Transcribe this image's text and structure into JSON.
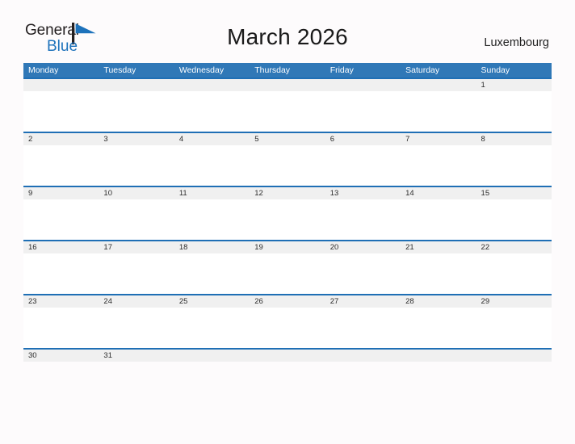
{
  "brand": {
    "name_part1": "General",
    "name_part2": "Blue",
    "flag_color": "#1d72bb",
    "pole_color": "#231f20"
  },
  "header": {
    "title": "March 2026",
    "region": "Luxembourg"
  },
  "colors": {
    "header_blue": "#3078b7",
    "divider_blue": "#1f6fb5",
    "day_strip_gray": "#f0f0f0",
    "page_background": "#fdfbfc",
    "text_dark": "#1a1a1a"
  },
  "calendar": {
    "month": "March",
    "year": "2026",
    "weekday_headers": [
      "Monday",
      "Tuesday",
      "Wednesday",
      "Thursday",
      "Friday",
      "Saturday",
      "Sunday"
    ],
    "weeks": [
      [
        "",
        "",
        "",
        "",
        "",
        "",
        "1"
      ],
      [
        "2",
        "3",
        "4",
        "5",
        "6",
        "7",
        "8"
      ],
      [
        "9",
        "10",
        "11",
        "12",
        "13",
        "14",
        "15"
      ],
      [
        "16",
        "17",
        "18",
        "19",
        "20",
        "21",
        "22"
      ],
      [
        "23",
        "24",
        "25",
        "26",
        "27",
        "28",
        "29"
      ],
      [
        "30",
        "31",
        "",
        "",
        "",
        "",
        ""
      ]
    ]
  }
}
